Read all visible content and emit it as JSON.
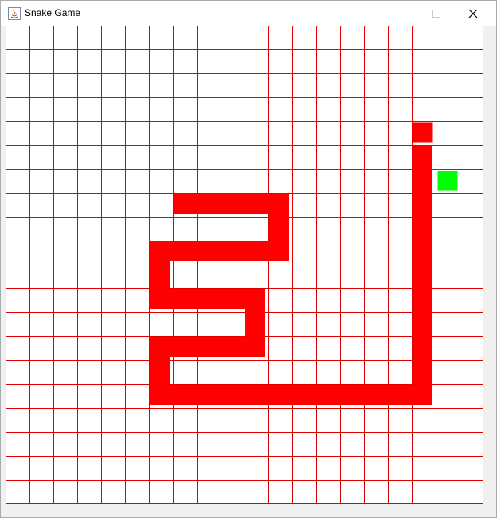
{
  "window": {
    "title": "Snake Game",
    "controls": [
      "minimize",
      "maximize",
      "close"
    ]
  },
  "game": {
    "grid": {
      "columns": 20,
      "rows": 20
    },
    "colors": {
      "grid_line": "#e00000",
      "snake": "#ff0000",
      "food": "#00ff00",
      "background": "#ffffff"
    },
    "snake": [
      [
        17,
        4
      ],
      [
        17,
        5
      ],
      [
        17,
        6
      ],
      [
        17,
        7
      ],
      [
        17,
        8
      ],
      [
        17,
        9
      ],
      [
        17,
        10
      ],
      [
        17,
        11
      ],
      [
        17,
        12
      ],
      [
        17,
        13
      ],
      [
        17,
        14
      ],
      [
        17,
        15
      ],
      [
        16,
        15
      ],
      [
        15,
        15
      ],
      [
        14,
        15
      ],
      [
        13,
        15
      ],
      [
        12,
        15
      ],
      [
        11,
        15
      ],
      [
        10,
        15
      ],
      [
        9,
        15
      ],
      [
        8,
        15
      ],
      [
        7,
        15
      ],
      [
        6,
        15
      ],
      [
        6,
        14
      ],
      [
        6,
        13
      ],
      [
        7,
        13
      ],
      [
        8,
        13
      ],
      [
        9,
        13
      ],
      [
        10,
        13
      ],
      [
        10,
        12
      ],
      [
        10,
        11
      ],
      [
        9,
        11
      ],
      [
        8,
        11
      ],
      [
        7,
        11
      ],
      [
        6,
        11
      ],
      [
        6,
        10
      ],
      [
        6,
        9
      ],
      [
        7,
        9
      ],
      [
        8,
        9
      ],
      [
        9,
        9
      ],
      [
        10,
        9
      ],
      [
        11,
        9
      ],
      [
        11,
        8
      ],
      [
        11,
        7
      ],
      [
        10,
        7
      ],
      [
        9,
        7
      ],
      [
        8,
        7
      ],
      [
        7,
        7
      ]
    ],
    "food": [
      18,
      6
    ]
  }
}
